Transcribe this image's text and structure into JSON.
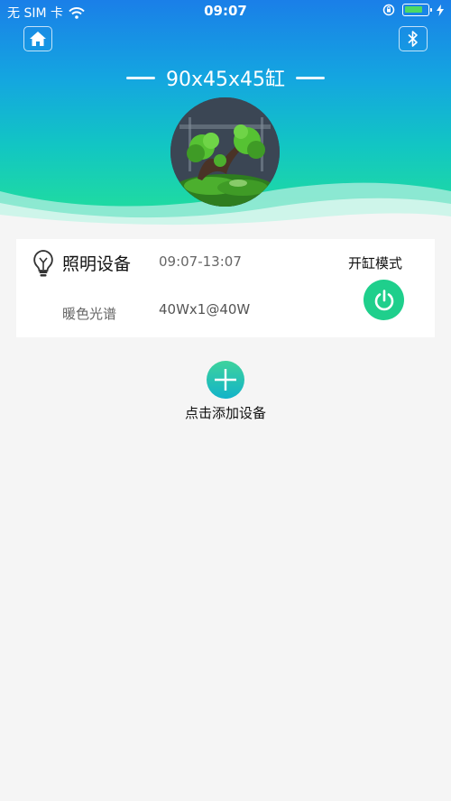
{
  "status_bar": {
    "carrier": "无 SIM 卡",
    "time": "09:07"
  },
  "header": {
    "tank_title": "90x45x45缸",
    "home_icon": "home-icon",
    "bluetooth_icon": "bluetooth-icon"
  },
  "device": {
    "name": "照明设备",
    "time_range": "09:07-13:07",
    "mode_label": "开缸模式",
    "spectrum": "暖色光谱",
    "power_info": "40Wx1@40W",
    "icon": "lightbulb-icon",
    "power_icon": "power-icon"
  },
  "add_device": {
    "label": "点击添加设备",
    "icon": "plus-icon"
  },
  "colors": {
    "gradient_top": "#1a7fe8",
    "gradient_bottom": "#1ed9a4",
    "power_green": "#1fcf8c",
    "background": "#f5f5f5"
  }
}
